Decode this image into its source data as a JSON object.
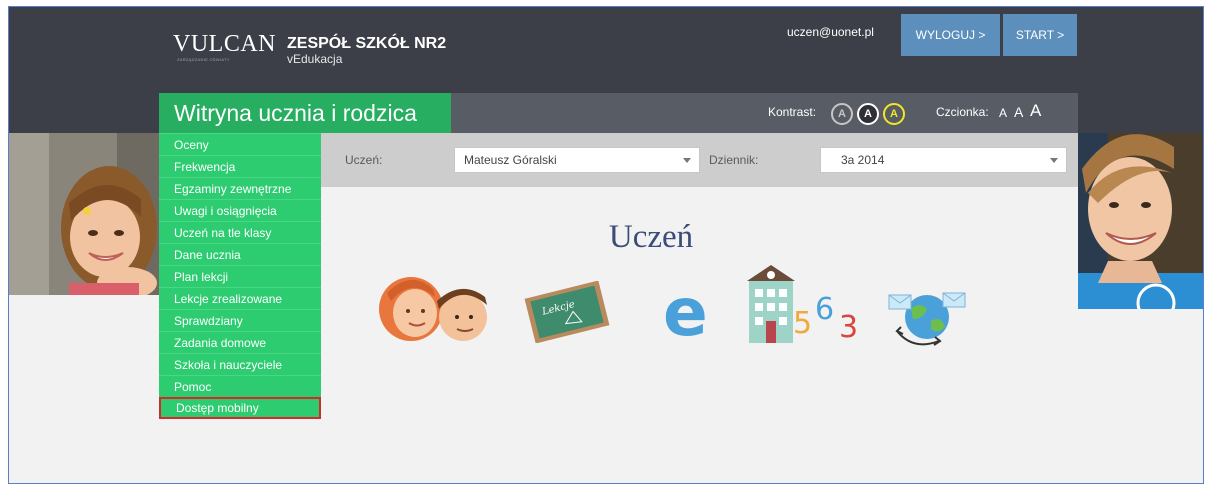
{
  "header": {
    "logo_text": "VULCAN",
    "logo_subtitle": "ZARZĄDZANIE OŚWIATY",
    "school_name": "ZESPÓŁ SZKÓŁ NR2",
    "school_subtitle": "vEdukacja",
    "user_email": "uczen@uonet.pl",
    "logout_label": "WYLOGUJ >",
    "start_label": "START >"
  },
  "titlebar": {
    "site_title": "Witryna ucznia i rodzica",
    "contrast_label": "Kontrast:",
    "contrast_options": [
      "A",
      "A",
      "A"
    ],
    "font_label": "Czcionka:",
    "font_options": [
      "A",
      "A",
      "A"
    ]
  },
  "sidebar": {
    "items": [
      {
        "label": "Oceny"
      },
      {
        "label": "Frekwencja"
      },
      {
        "label": "Egzaminy zewnętrzne"
      },
      {
        "label": "Uwagi i osiągnięcia"
      },
      {
        "label": "Uczeń na tle klasy"
      },
      {
        "label": "Dane ucznia"
      },
      {
        "label": "Plan lekcji"
      },
      {
        "label": "Lekcje zrealizowane"
      },
      {
        "label": "Sprawdziany"
      },
      {
        "label": "Zadania domowe"
      },
      {
        "label": "Szkoła i nauczyciele"
      },
      {
        "label": "Pomoc"
      },
      {
        "label": "Dostęp mobilny"
      }
    ]
  },
  "filters": {
    "student_label": "Uczeń:",
    "student_value": "Mateusz Góralski",
    "journal_label": "Dziennik:",
    "journal_value": "3a 2014"
  },
  "main": {
    "heading": "Uczeń",
    "board_text": "Lekcje",
    "numbers_text": [
      "5",
      "6",
      "3"
    ],
    "e_letter": "e"
  },
  "colors": {
    "menu_green": "#2ecc71",
    "title_green": "#27ae60",
    "header_dark": "#3c3f47",
    "button_blue": "#5d8fbd",
    "highlight_red": "#d62a2a"
  }
}
